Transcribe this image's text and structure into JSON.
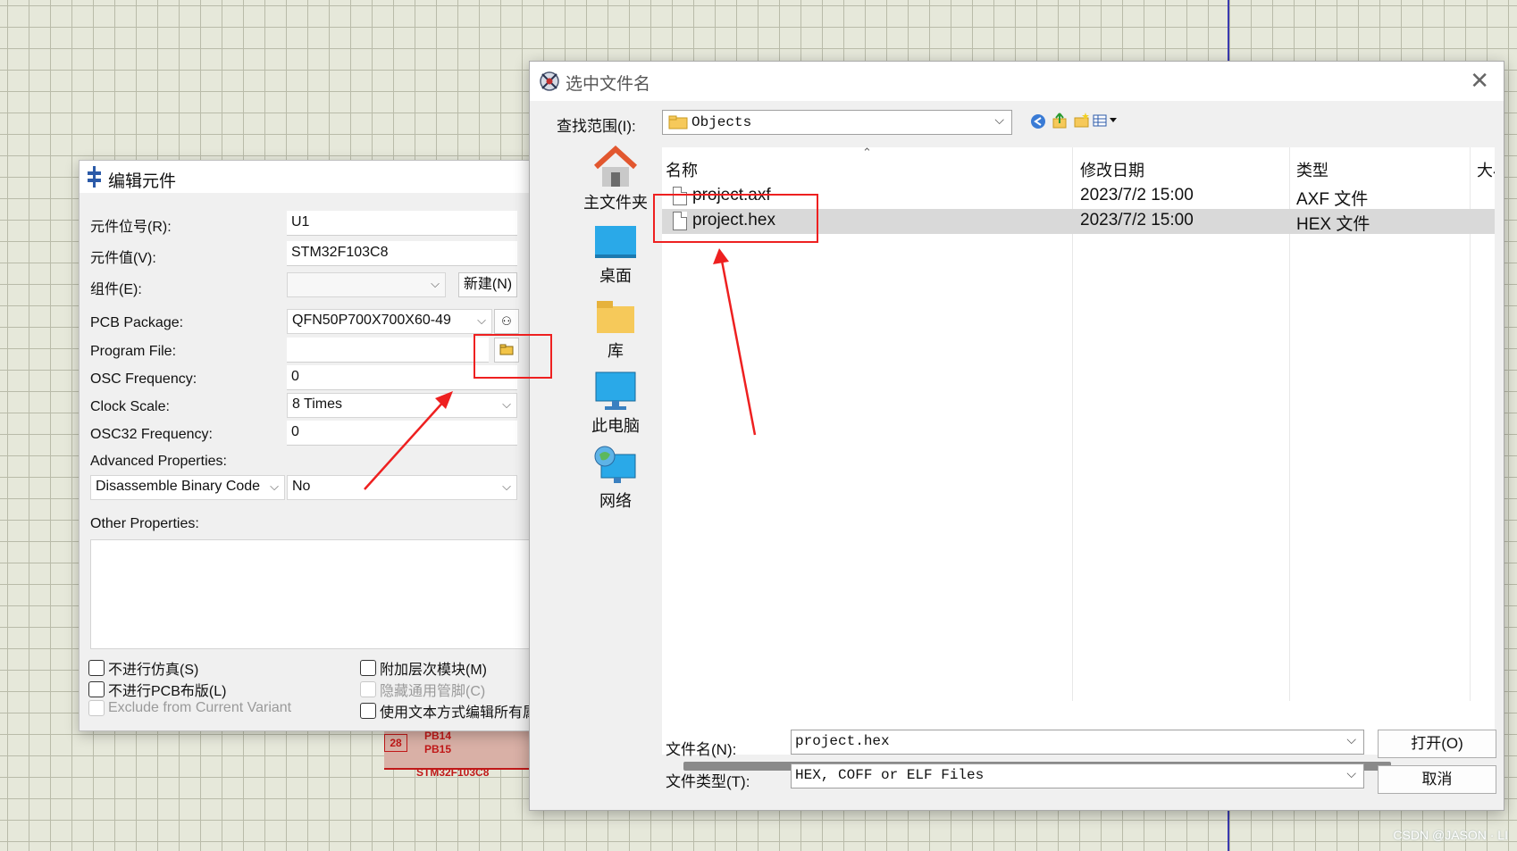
{
  "canvas": {
    "schematic": {
      "pin_number": "28",
      "pin_labels": [
        "PB14",
        "PB15"
      ],
      "part_label": "STM32F103C8"
    },
    "watermark": "CSDN @JASON · LI"
  },
  "edit_component": {
    "title": "编辑元件",
    "fields": {
      "ref_label": "元件位号(R):",
      "ref_value": "U1",
      "value_label": "元件值(V):",
      "value_value": "STM32F103C8",
      "group_label": "组件(E):",
      "group_value": "",
      "new_button": "新建(N)",
      "pcb_label": "PCB Package:",
      "pcb_value": "QFN50P700X700X60-49",
      "program_label": "Program File:",
      "program_value": "",
      "osc_label": "OSC Frequency:",
      "osc_value": "0",
      "clock_label": "Clock Scale:",
      "clock_value": "8 Times",
      "osc32_label": "OSC32 Frequency:",
      "osc32_value": "0",
      "advanced_label": "Advanced Properties:",
      "advanced_property": "Disassemble Binary Code",
      "advanced_value": "No",
      "other_label": "Other Properties:"
    },
    "checkboxes": {
      "no_sim": "不进行仿真(S)",
      "no_pcb": "不进行PCB布版(L)",
      "exclude_variant": "Exclude from Current Variant",
      "attach_hier": "附加层次模块(M)",
      "hide_pins": "隐藏通用管脚(C)",
      "edit_text": "使用文本方式编辑所有属"
    }
  },
  "file_dialog": {
    "title": "选中文件名",
    "look_in_label": "查找范围(I):",
    "look_in_value": "Objects",
    "places": [
      "主文件夹",
      "桌面",
      "库",
      "此电脑",
      "网络"
    ],
    "columns": [
      "名称",
      "修改日期",
      "类型",
      "大小"
    ],
    "files": [
      {
        "name": "project.axf",
        "date": "2023/7/2 15:00",
        "type": "AXF 文件",
        "selected": false
      },
      {
        "name": "project.hex",
        "date": "2023/7/2 15:00",
        "type": "HEX 文件",
        "selected": true
      }
    ],
    "filename_label": "文件名(N):",
    "filename_value": "project.hex",
    "filetype_label": "文件类型(T):",
    "filetype_value": "HEX, COFF or ELF Files",
    "open_button": "打开(O)",
    "cancel_button": "取消"
  }
}
